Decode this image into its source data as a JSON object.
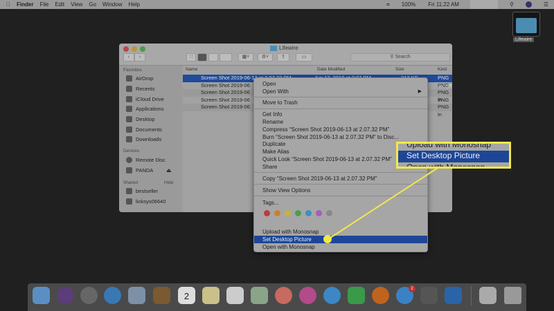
{
  "menubar": {
    "apple": "",
    "app": "Finder",
    "items": [
      "File",
      "Edit",
      "View",
      "Go",
      "Window",
      "Help"
    ],
    "battery": "100%",
    "clock": "Fri 11:22 AM"
  },
  "desktop": {
    "folder_label": "Lifewire"
  },
  "window": {
    "title": "Lifewire",
    "search_placeholder": "Search",
    "sidebar": {
      "favorites_header": "Favorites",
      "favorites": [
        "AirDrop",
        "Recents",
        "iCloud Drive",
        "Applications",
        "Desktop",
        "Documents",
        "Downloads"
      ],
      "devices_header": "Devices",
      "devices": [
        "Remote Disc",
        "PANDA"
      ],
      "shared_header": "Shared",
      "shared_hide": "Hide",
      "shared": [
        "bestseller",
        "linksys06640"
      ]
    },
    "columns": [
      "Name",
      "Date Modified",
      "Size",
      "Kind"
    ],
    "files": [
      {
        "name": "Screen Shot 2019-06-13 at 2.07.32 PM",
        "date": "Jun 13, 2019 at 2:07 PM",
        "size": "313 KB",
        "kind": "PNG image"
      },
      {
        "name": "Screen Shot 2019-06",
        "kind": "PNG in"
      },
      {
        "name": "Screen Shot 2019-06",
        "kind": "PNG in"
      },
      {
        "name": "Screen Shot 2019-06",
        "kind": "PNG in"
      },
      {
        "name": "Screen Shot 2019-06",
        "kind": "PNG in"
      }
    ]
  },
  "context_menu": {
    "items": [
      "Open",
      "Open With",
      "Move to Trash",
      "Get Info",
      "Rename",
      "Compress “Screen Shot 2019-06-13 at 2.07.32 PM”",
      "Burn “Screen Shot 2019-06-13 at 2.07.32 PM” to Disc...",
      "Duplicate",
      "Make Alias",
      "Quick Look “Screen Shot 2019-06-13 at 2.07.32 PM”",
      "Share",
      "Copy “Screen Shot 2019-06-13 at 2.07.32 PM”",
      "Show View Options",
      "Tags...",
      "Upload with Monosnap",
      "Set Desktop Picture",
      "Open with Monosnap"
    ],
    "highlighted": "Set Desktop Picture",
    "tag_colors": [
      "#c0393b",
      "#c8812a",
      "#c7b23a",
      "#4aa04a",
      "#3d8fc4",
      "#a85bbf",
      "#888888"
    ]
  },
  "callout": {
    "items": [
      "Upload with Monosnap",
      "Set Desktop Picture",
      "Open with Monosnap"
    ],
    "color": "#f2e84a"
  },
  "dock": {
    "apps": [
      "Finder",
      "Siri",
      "Launchpad",
      "Safari",
      "Mail",
      "Contacts",
      "Calendar",
      "Notes",
      "Reminders",
      "Maps",
      "Photos",
      "iTunes",
      "Messages",
      "FaceTime",
      "Books",
      "App Store",
      "System Preferences",
      "Outlook",
      "Documents",
      "Trash"
    ],
    "calendar_day": "2",
    "app_store_badge": "2"
  }
}
